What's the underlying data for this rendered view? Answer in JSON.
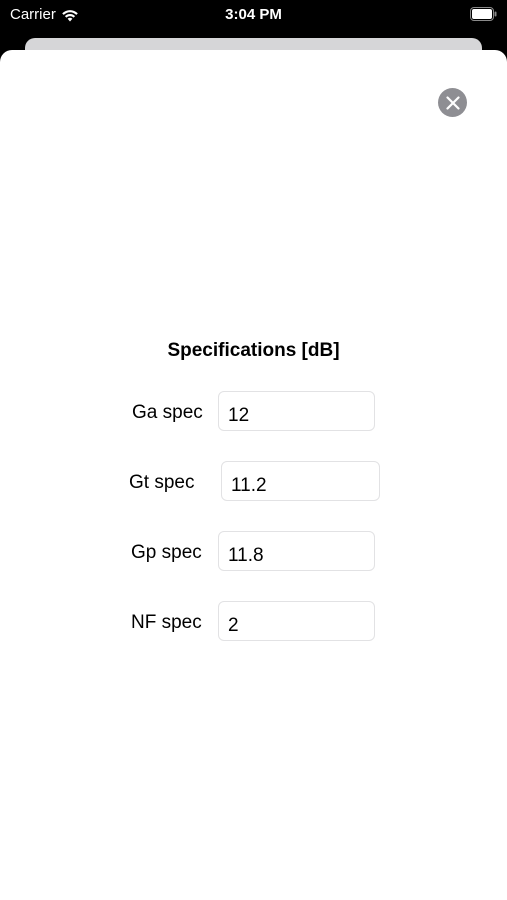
{
  "status_bar": {
    "carrier": "Carrier",
    "time": "3:04 PM",
    "icons": [
      "wifi-icon",
      "battery-icon"
    ]
  },
  "sheet": {
    "close_icon": "close-icon",
    "title": "Specifications [dB]",
    "fields": [
      {
        "label": "Ga spec",
        "value": "12"
      },
      {
        "label": "Gt spec",
        "value": "11.2"
      },
      {
        "label": "Gp spec",
        "value": "11.8"
      },
      {
        "label": "NF spec",
        "value": "2"
      }
    ]
  },
  "colors": {
    "status_bar_bg": "#000000",
    "sheet_bg": "#ffffff",
    "close_button": "#8e8e93",
    "field_border": "#e2e2e4"
  }
}
